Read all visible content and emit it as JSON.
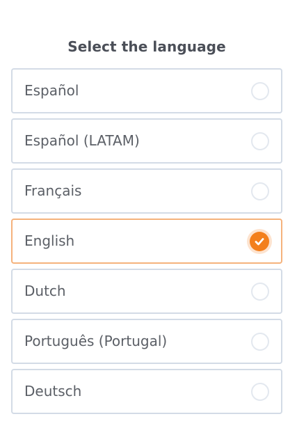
{
  "title": "Select the language",
  "accent_color": "#f37f1c",
  "languages": [
    {
      "label": "Español",
      "selected": false
    },
    {
      "label": "Español (LATAM)",
      "selected": false
    },
    {
      "label": "Français",
      "selected": false
    },
    {
      "label": "English",
      "selected": true,
      "icon": "checkmark-icon"
    },
    {
      "label": "Dutch",
      "selected": false
    },
    {
      "label": "Português (Portugal)",
      "selected": false
    },
    {
      "label": "Deutsch",
      "selected": false
    }
  ]
}
